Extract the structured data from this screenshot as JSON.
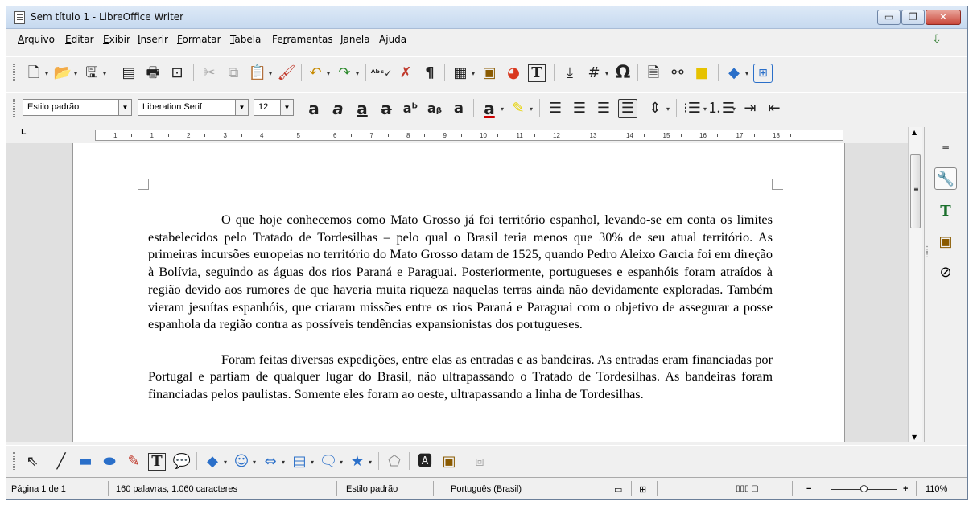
{
  "window": {
    "title": "Sem título 1 - LibreOffice Writer",
    "minimize": "▭",
    "maximize": "❐",
    "close": "✕"
  },
  "menu": [
    {
      "accel": "A",
      "rest": "rquivo"
    },
    {
      "accel": "E",
      "rest": "ditar"
    },
    {
      "accel": "E",
      "rest": "xibir"
    },
    {
      "accel": "I",
      "rest": "nserir"
    },
    {
      "accel": "F",
      "rest": "ormatar"
    },
    {
      "accel": "T",
      "rest": "abela"
    },
    {
      "accel": "F",
      "rest": "e",
      "rest2": "r",
      "rest3": "ramentas"
    },
    {
      "accel": "J",
      "rest": "anela"
    },
    {
      "accel": "A",
      "rest": "j",
      "rest2": "u",
      "rest3": "da"
    }
  ],
  "formatting": {
    "paragraph_style": "Estilo padrão",
    "font_name": "Liberation Serif",
    "font_size": "12"
  },
  "ruler": {
    "numbers": [
      "1",
      "1",
      "2",
      "3",
      "4",
      "5",
      "6",
      "7",
      "8",
      "9",
      "10",
      "11",
      "12",
      "13",
      "14",
      "15",
      "16",
      "17",
      "18"
    ]
  },
  "document": {
    "paragraphs": [
      "O que hoje conhecemos como Mato Grosso já foi território espanhol, levando-se em conta os limites estabelecidos pelo Tratado de Tordesilhas – pelo qual o Brasil teria menos que 30% de seu atual território. As primeiras incursões europeias no território do Mato Grosso datam de 1525, quando Pedro Aleixo Garcia foi em direção à Bolívia, seguindo as águas dos rios Paraná e Paraguai. Posteriormente, portugueses e espanhóis foram atraídos à região devido aos rumores de que haveria muita riqueza naquelas terras ainda não devidamente exploradas. Também vieram jesuítas espanhóis, que criaram missões entre os rios Paraná e Paraguai com o objetivo de assegurar a posse espanhola da região contra as possíveis tendências expansionistas dos portugueses.",
      "Foram feitas diversas expedições, entre elas as entradas e as bandeiras. As entradas eram financiadas por Portugal e partiam de qualquer lugar do Brasil, não ultrapassando o Tratado de Tordesilhas. As bandeiras foram financiadas pelos paulistas. Somente eles foram ao oeste, ultrapassando a linha de Tordesilhas."
    ]
  },
  "status": {
    "page": "Página 1 de 1",
    "words": "160 palavras, 1.060 caracteres",
    "style": "Estilo padrão",
    "language": "Português (Brasil)",
    "zoom_minus": "−",
    "zoom_plus": "+",
    "zoom": "110%"
  },
  "icons": {
    "standard_toolbar": [
      "new-document-icon",
      "open-icon",
      "save-icon",
      "export-pdf-icon",
      "print-icon",
      "print-preview-icon",
      "cut-icon",
      "copy-icon",
      "paste-icon",
      "clone-formatting-icon",
      "undo-icon",
      "redo-icon",
      "spellcheck-icon",
      "autocorrect-icon",
      "formatting-marks-icon",
      "insert-table-icon",
      "insert-image-icon",
      "insert-chart-icon",
      "insert-textbox-icon",
      "insert-page-break-icon",
      "insert-field-icon",
      "special-character-icon",
      "insert-footnote-icon",
      "hyperlink-icon",
      "insert-comment-icon",
      "basic-shapes-icon",
      "show-draw-functions-icon"
    ],
    "drawing_toolbar": [
      "select-icon",
      "line-icon",
      "rectangle-icon",
      "ellipse-icon",
      "freeform-icon",
      "textbox-icon",
      "callout-icon",
      "diamond-icon",
      "smiley-icon",
      "double-arrow-icon",
      "flowchart-icon",
      "speech-bubble-icon",
      "star-icon",
      "points-icon",
      "fontwork-icon",
      "image-icon",
      "extrusion-icon"
    ]
  }
}
